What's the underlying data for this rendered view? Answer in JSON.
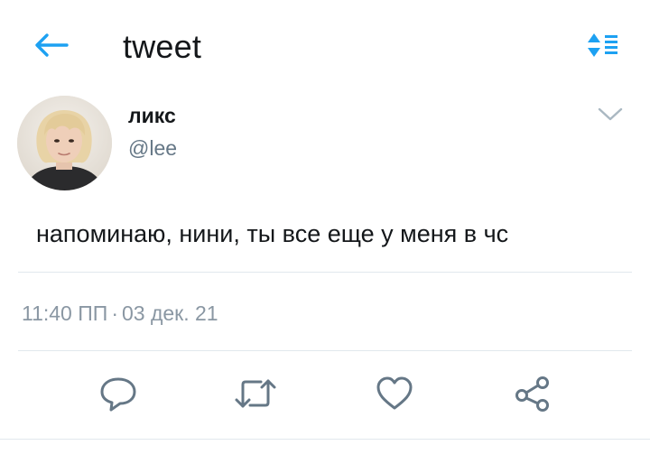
{
  "header": {
    "title": "tweet",
    "back_icon": "arrow-left-icon",
    "sort_icon": "sort-updown-icon",
    "accent_color": "#1da1f2"
  },
  "tweet": {
    "author": {
      "display_name": "ликс",
      "handle": "@lee"
    },
    "text": "напоминаю, нини, ты все еще у меня в чс",
    "time": "11:40 ПП",
    "separator": "·",
    "date": "03 дек. 21"
  },
  "actions": [
    {
      "name": "reply",
      "icon": "reply-icon"
    },
    {
      "name": "retweet",
      "icon": "retweet-icon"
    },
    {
      "name": "like",
      "icon": "heart-icon"
    },
    {
      "name": "share",
      "icon": "share-icon"
    }
  ],
  "colors": {
    "text_primary": "#14171a",
    "text_secondary": "#657786",
    "icon_gray": "#657786",
    "divider": "#e1e8ed"
  }
}
